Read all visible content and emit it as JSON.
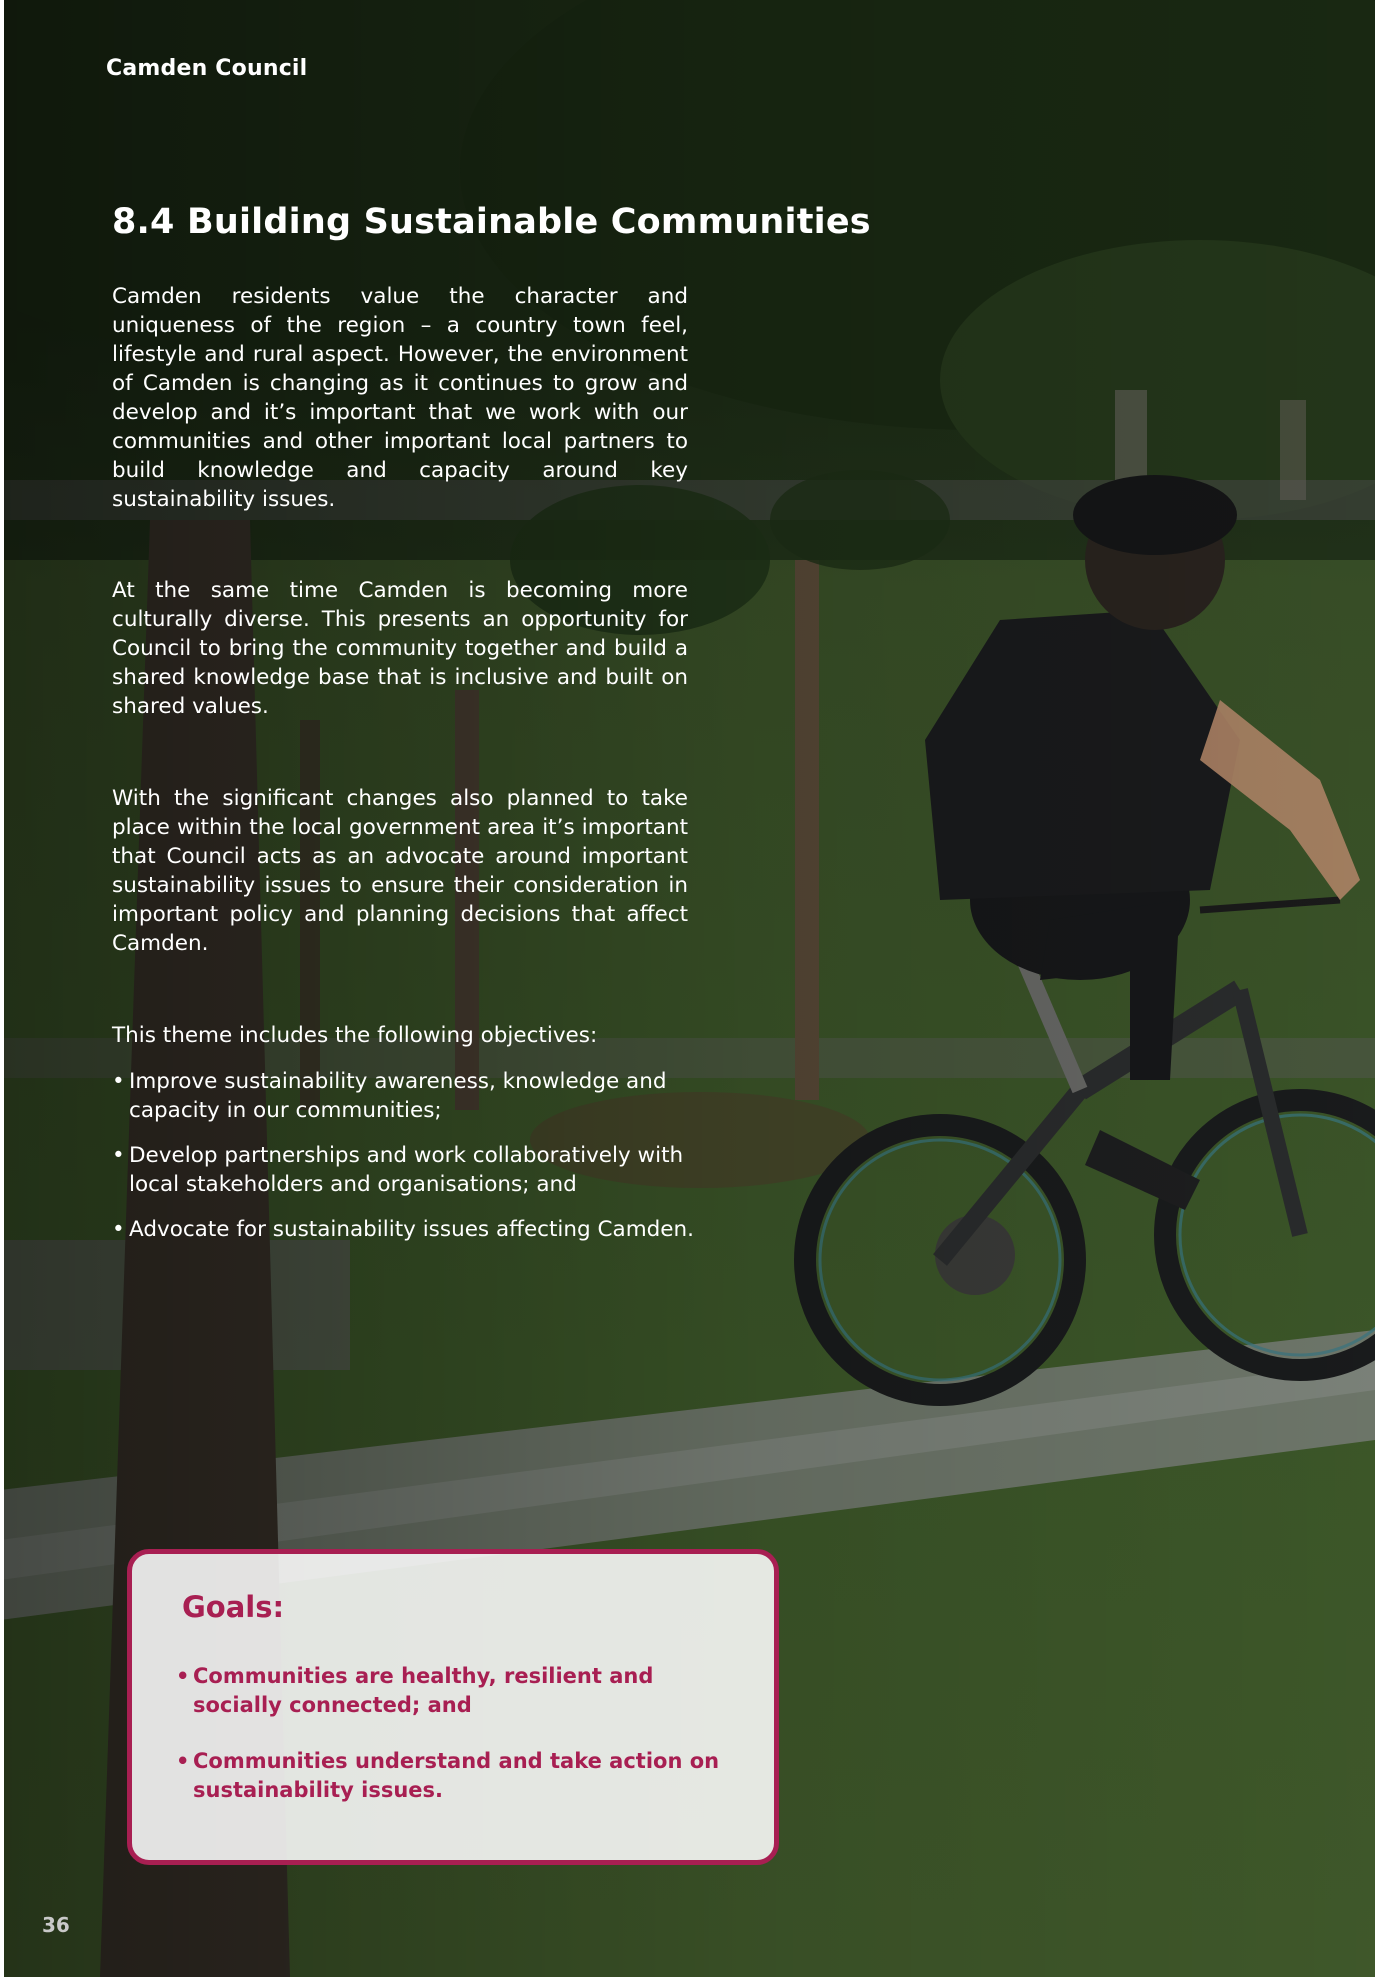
{
  "header": {
    "organisation": "Camden Council"
  },
  "section": {
    "title": "8.4 Building Sustainable Communities"
  },
  "paragraphs": [
    "Camden residents value the character and uniqueness of the region – a country town feel, lifestyle and rural aspect. However, the environment of Camden is changing as it continues to grow and develop and it’s important that we work with our communities and other important local partners to build knowledge and capacity around key sustainability issues.",
    "At the same time Camden is becoming more culturally diverse. This presents an opportunity for Council to bring the community together and build a shared knowledge base that is inclusive and built on shared values.",
    "With the significant changes also planned to take place within the local government area it’s important that Council acts as an advocate around important sustainability issues to ensure their consideration in important policy and planning decisions that affect Camden."
  ],
  "objectives": {
    "intro": "This theme includes the following objectives:",
    "bullet": "•",
    "items": [
      "Improve sustainability awareness, knowledge and capacity in our communities;",
      "Develop partnerships and work collaboratively with local stakeholders and organisations; and",
      "Advocate for sustainability issues affecting Camden."
    ]
  },
  "goals": {
    "title": "Goals:",
    "bullet": "•",
    "items": [
      "Communities are healthy, resilient and socially connected; and",
      "Communities understand and take action on sustainability issues."
    ]
  },
  "page_number": "36",
  "colors": {
    "accent": "#a81f52",
    "text": "#ffffff",
    "goals_box": "#f1efef"
  }
}
